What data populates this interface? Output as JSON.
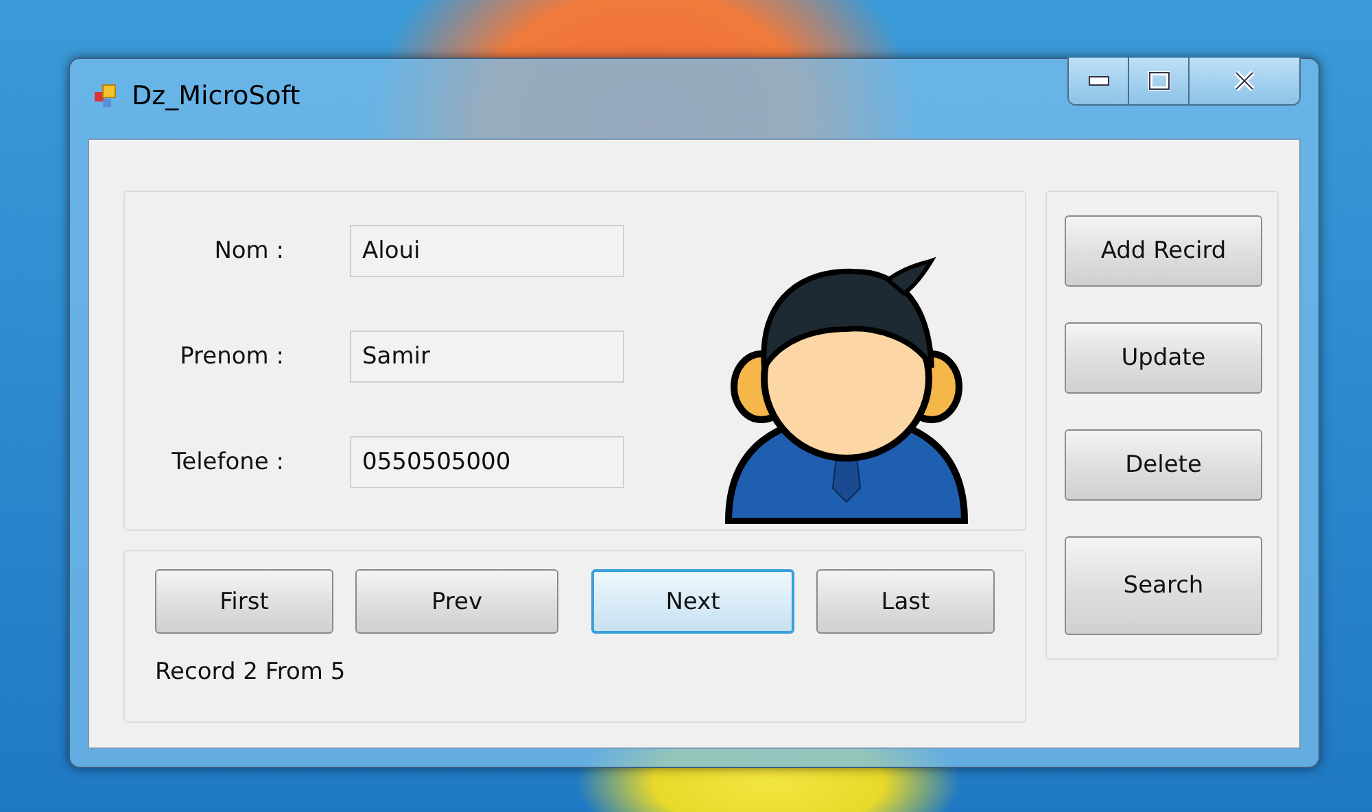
{
  "window": {
    "title": "Dz_MicroSoft"
  },
  "fields": [
    {
      "label": "Nom :",
      "value": "Aloui"
    },
    {
      "label": "Prenom :",
      "value": "Samir"
    },
    {
      "label": "Telefone :",
      "value": "0550505000"
    }
  ],
  "navigation": [
    {
      "label": "First",
      "focused": false
    },
    {
      "label": "Prev",
      "focused": false
    },
    {
      "label": "Next",
      "focused": true
    },
    {
      "label": "Last",
      "focused": false
    }
  ],
  "record_status": "Record 2 From 5",
  "actions": [
    {
      "label": "Add Recird"
    },
    {
      "label": "Update"
    },
    {
      "label": "Delete"
    },
    {
      "label": "Search"
    }
  ]
}
